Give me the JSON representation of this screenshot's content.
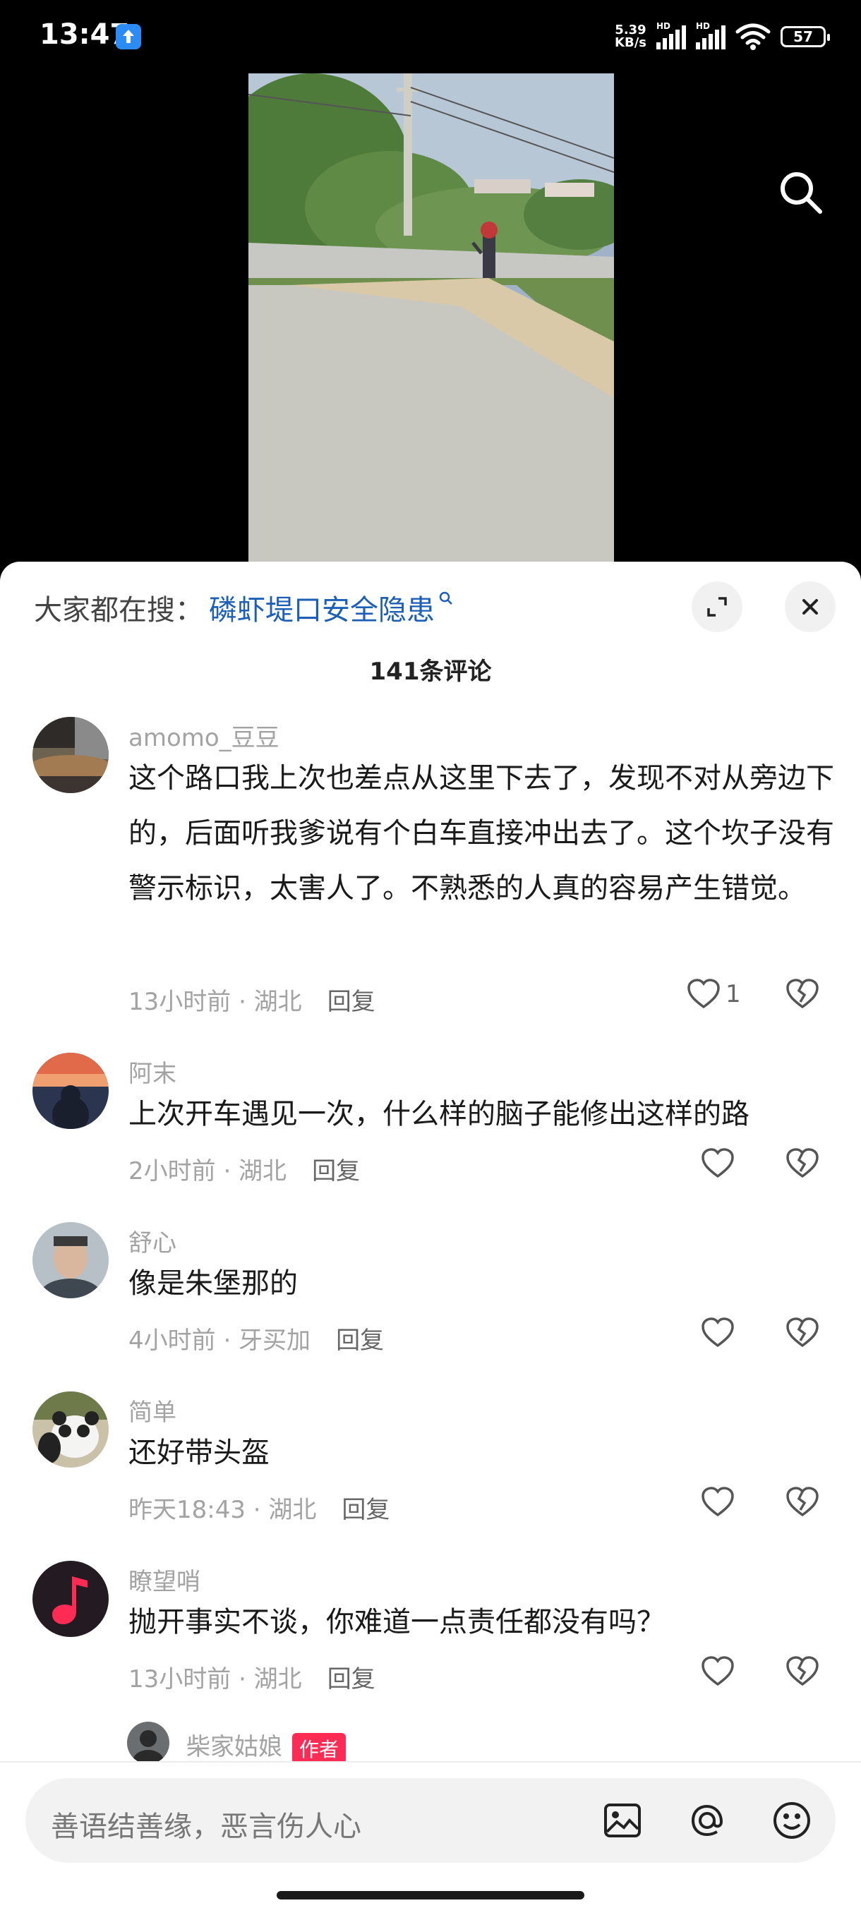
{
  "status_bar": {
    "time": "13:47",
    "net_speed_value": "5.39",
    "net_speed_unit": "KB/s",
    "hd_label": "HD",
    "battery": "57"
  },
  "icons": {
    "search": "search-icon",
    "expand": "expand-icon",
    "close": "close-icon",
    "like": "heart-icon",
    "dislike": "broken-heart-icon",
    "image": "image-icon",
    "mention": "at-icon",
    "emoji": "emoji-icon"
  },
  "hot_search": {
    "label": "大家都在搜：",
    "query": "磷虾堤口安全隐患"
  },
  "comment_count_title": "141条评论",
  "reply_label": "回复",
  "comments": [
    {
      "name": "amomo_豆豆",
      "text": "这个路口我上次也差点从这里下去了，发现不对从旁边下的，后面听我爹说有个白车直接冲出去了。这个坎子没有警示标识，太害人了。不熟悉的人真的容易产生错觉。",
      "meta": "13小时前 · 湖北",
      "likes": "1"
    },
    {
      "name": "阿末",
      "text": "上次开车遇见一次，什么样的脑子能修出这样的路",
      "meta": "2小时前 · 湖北",
      "likes": ""
    },
    {
      "name": "舒心",
      "text": "像是朱堡那的",
      "meta": "4小时前 · 牙买加",
      "likes": ""
    },
    {
      "name": "简单",
      "text": "还好带头盔",
      "meta": "昨天18:43 · 湖北",
      "likes": ""
    },
    {
      "name": "瞭望哨",
      "text": "抛开事实不谈，你难道一点责任都没有吗？",
      "meta": "13小时前 · 湖北",
      "likes": ""
    }
  ],
  "author_reply": {
    "name": "柴家姑娘",
    "badge": "作者"
  },
  "input": {
    "placeholder": "善语结善缘，恶言伤人心"
  },
  "colors": {
    "link_blue": "#1d5fb5",
    "author_badge": "#fe2c55",
    "muted_text": "#a3a3a3"
  }
}
